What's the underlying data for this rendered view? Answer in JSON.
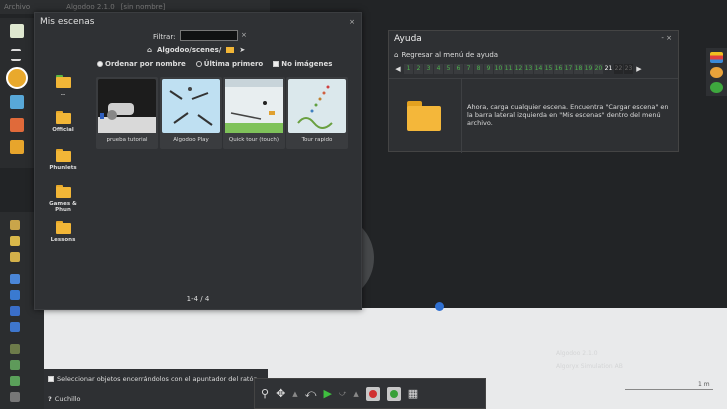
{
  "topbar": {
    "menu_label": "Archivo",
    "tab1": "Algodoo 2.1.0",
    "tab2": "[sin nombre]"
  },
  "scenes": {
    "title": "Mis escenas",
    "close": "×",
    "filter_label": "Filtrar:",
    "filter_value": "",
    "clear": "×",
    "path": "Algodoo/scenes/",
    "sort_name": "Ordenar por nombre",
    "sort_recent": "Última primero",
    "no_images": "No imágenes",
    "folders": [
      {
        "label": "..",
        "color": "green"
      },
      {
        "label": "Official",
        "color": "yellow"
      },
      {
        "label": "Phunlets",
        "color": "yellow"
      },
      {
        "label": "Games & Phun",
        "color": "yellow"
      },
      {
        "label": "Lessons",
        "color": "yellow"
      }
    ],
    "scenes": [
      {
        "label": "prueba tutorial"
      },
      {
        "label": "Algodoo Play"
      },
      {
        "label": "Quick tour (touch)"
      },
      {
        "label": "Tour rapido"
      }
    ],
    "pager": "1-4 / 4"
  },
  "help": {
    "title": "Ayuda",
    "controls": "- ×",
    "back": "Regresar al menú de ayuda",
    "pages": [
      "1",
      "2",
      "3",
      "4",
      "5",
      "6",
      "7",
      "8",
      "9",
      "10",
      "11",
      "12",
      "13",
      "14",
      "15",
      "16",
      "17",
      "18",
      "19",
      "20",
      "21",
      "22",
      "23"
    ],
    "current_page": "21",
    "text": "Ahora, carga cualquier escena. Encuentra \"Cargar escena\" en la barra lateral izquierda en \"Mis escenas\" dentro del menú archivo."
  },
  "bottom": {
    "checkbox_label": "Seleccionar objetos encerrándolos con el apuntador del ratón",
    "tool_name": "Cuchillo"
  },
  "scale": {
    "label": "1 m"
  },
  "ground_text": {
    "line1": "Algodoo 2.1.0",
    "line2": "Algoryx Simulation AB"
  }
}
